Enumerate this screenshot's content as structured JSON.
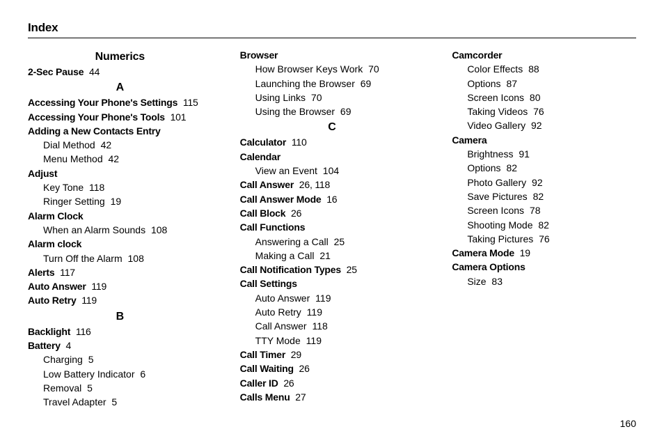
{
  "pageTitle": "Index",
  "pageNumber": "160",
  "sections": [
    {
      "heading": "Numerics",
      "entries": [
        {
          "t": "2-Sec Pause",
          "p": "44"
        }
      ]
    },
    {
      "heading": "A",
      "entries": [
        {
          "t": "Accessing Your Phone's Settings",
          "p": "115"
        },
        {
          "t": "Accessing Your Phone's Tools",
          "p": "101"
        },
        {
          "t": "Adding a New Contacts Entry",
          "subs": [
            {
              "t": "Dial Method",
              "p": "42"
            },
            {
              "t": "Menu Method",
              "p": "42"
            }
          ]
        },
        {
          "t": "Adjust",
          "subs": [
            {
              "t": "Key Tone",
              "p": "118"
            },
            {
              "t": "Ringer Setting",
              "p": "19"
            }
          ]
        },
        {
          "t": "Alarm Clock",
          "subs": [
            {
              "t": "When an Alarm Sounds",
              "p": "108"
            }
          ]
        },
        {
          "t": "Alarm clock",
          "subs": [
            {
              "t": "Turn Off the Alarm",
              "p": "108"
            }
          ]
        },
        {
          "t": "Alerts",
          "p": "117"
        },
        {
          "t": "Auto Answer",
          "p": "119"
        },
        {
          "t": "Auto Retry",
          "p": "119"
        }
      ]
    },
    {
      "heading": "B",
      "entries": [
        {
          "t": "Backlight",
          "p": "116"
        },
        {
          "t": "Battery",
          "p": "4",
          "subs": [
            {
              "t": "Charging",
              "p": "5"
            },
            {
              "t": "Low Battery Indicator",
              "p": "6"
            },
            {
              "t": "Removal",
              "p": "5"
            },
            {
              "t": "Travel Adapter",
              "p": "5"
            }
          ]
        },
        {
          "t": "Browser",
          "subs": [
            {
              "t": "How Browser Keys Work",
              "p": "70"
            },
            {
              "t": "Launching the Browser",
              "p": "69"
            },
            {
              "t": "Using Links",
              "p": "70"
            },
            {
              "t": "Using the Browser",
              "p": "69"
            }
          ]
        }
      ]
    },
    {
      "heading": "C",
      "entries": [
        {
          "t": "Calculator",
          "p": "110"
        },
        {
          "t": "Calendar",
          "subs": [
            {
              "t": "View an Event",
              "p": "104"
            }
          ]
        },
        {
          "t": "Call Answer",
          "p": "26, 118"
        },
        {
          "t": "Call Answer Mode",
          "p": "16"
        },
        {
          "t": "Call Block",
          "p": "26"
        },
        {
          "t": "Call Functions",
          "subs": [
            {
              "t": "Answering a Call",
              "p": "25"
            },
            {
              "t": "Making a Call",
              "p": "21"
            }
          ]
        },
        {
          "t": "Call Notification Types",
          "p": "25"
        },
        {
          "t": "Call Settings",
          "subs": [
            {
              "t": "Auto Answer",
              "p": "119"
            },
            {
              "t": "Auto Retry",
              "p": "119"
            },
            {
              "t": "Call Answer",
              "p": "118"
            },
            {
              "t": "TTY Mode",
              "p": "119"
            }
          ]
        },
        {
          "t": "Call Timer",
          "p": "29"
        },
        {
          "t": "Call Waiting",
          "p": "26"
        },
        {
          "t": "Caller ID",
          "p": "26"
        },
        {
          "t": "Calls Menu",
          "p": "27"
        },
        {
          "t": "Camcorder",
          "subs": [
            {
              "t": "Color Effects",
              "p": "88"
            },
            {
              "t": "Options",
              "p": "87"
            },
            {
              "t": "Screen Icons",
              "p": "80"
            },
            {
              "t": "Taking Videos",
              "p": "76"
            },
            {
              "t": "Video Gallery",
              "p": "92"
            }
          ]
        },
        {
          "t": "Camera",
          "subs": [
            {
              "t": "Brightness",
              "p": "91"
            },
            {
              "t": "Options",
              "p": "82"
            },
            {
              "t": "Photo Gallery",
              "p": "92"
            },
            {
              "t": "Save Pictures",
              "p": "82"
            },
            {
              "t": "Screen Icons",
              "p": "78"
            },
            {
              "t": "Shooting Mode",
              "p": "82"
            },
            {
              "t": "Taking Pictures",
              "p": "76"
            }
          ]
        },
        {
          "t": "Camera Mode",
          "p": "19"
        },
        {
          "t": "Camera Options",
          "subs": [
            {
              "t": "Size",
              "p": "83"
            }
          ]
        }
      ]
    }
  ]
}
